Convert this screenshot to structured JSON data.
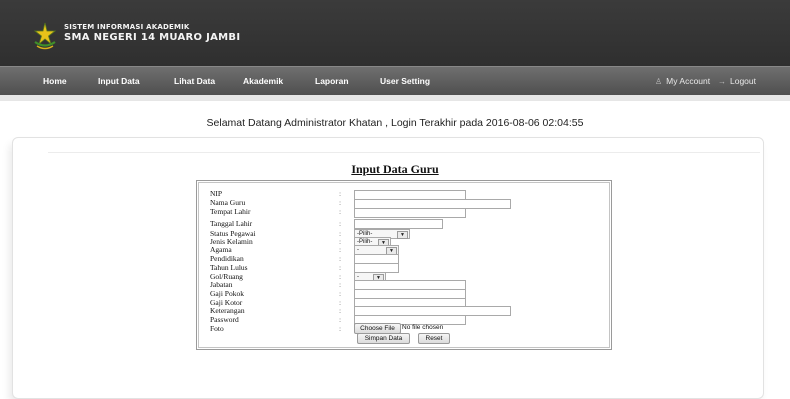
{
  "header": {
    "school_line1": "SISTEM INFORMASI AKADEMIK",
    "school_line2": "SMA NEGERI 14 MUARO JAMBI",
    "logo_icon": "school-emblem-icon"
  },
  "nav": {
    "items": [
      "Home",
      "Input Data",
      "Lihat Data",
      "Akademik",
      "Laporan",
      "User Setting"
    ],
    "my_account": "My Account",
    "logout": "Logout",
    "my_account_icon": "user-icon",
    "logout_icon": "arrow-right-icon"
  },
  "welcome": "Selamat Datang Administrator Khatan , Login Terakhir pada 2016-08-06 02:04:55",
  "form": {
    "title": "Input Data Guru",
    "labels": [
      "NIP",
      "Nama Guru",
      "Tempat Lahir",
      "Tanggal Lahir",
      "Status Pegawai",
      "Jenis Kelamin",
      "Agama",
      "Pendidikan",
      "Tahun Lulus",
      "Gol/Ruang",
      "Jabatan",
      "Gaji Pokok",
      "Gaji Kotor",
      "Keterangan",
      "Password",
      "Foto"
    ],
    "colon": ":",
    "status_pegawai_selected": "-Pilih-",
    "jenis_kelamin_selected": "-Pilih-",
    "agama_selected": "-",
    "gol_ruang_selected": "-",
    "choose_file": "Choose File",
    "no_file": "No file chosen",
    "save_button": "Simpan Data",
    "reset_button": "Reset"
  }
}
